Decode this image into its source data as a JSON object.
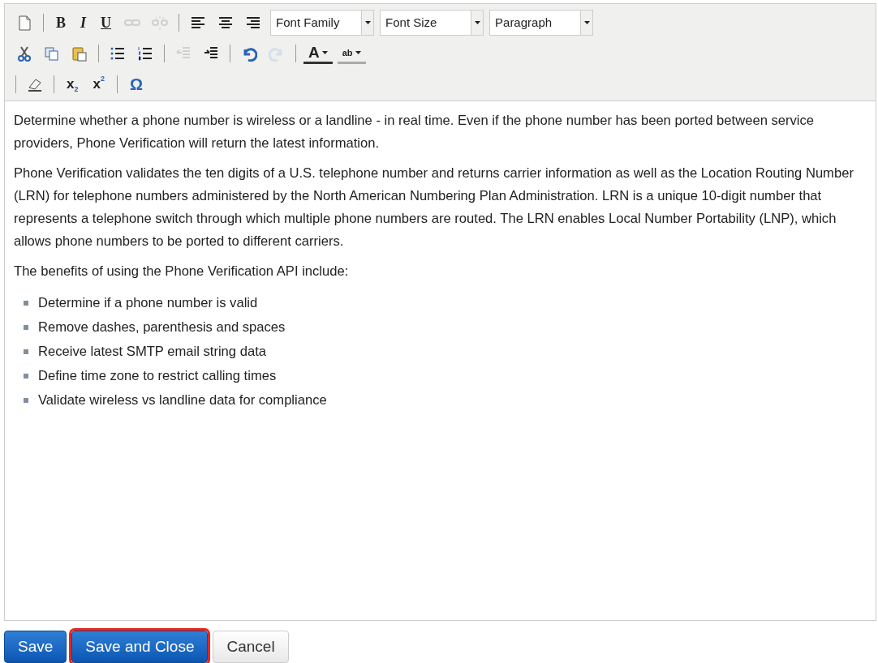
{
  "toolbar": {
    "lines": [
      {
        "items": [
          {
            "kind": "new-document",
            "disabled": false
          },
          {
            "kind": "separator"
          },
          {
            "kind": "bold",
            "glyph": "B",
            "disabled": false
          },
          {
            "kind": "italic",
            "glyph": "I",
            "disabled": false
          },
          {
            "kind": "underline",
            "glyph": "U",
            "disabled": false
          },
          {
            "kind": "link",
            "disabled": true
          },
          {
            "kind": "unlink",
            "disabled": true
          },
          {
            "kind": "separator"
          },
          {
            "kind": "align-left",
            "disabled": false
          },
          {
            "kind": "align-center",
            "disabled": false
          },
          {
            "kind": "align-right",
            "disabled": false
          },
          {
            "kind": "select",
            "value": "Font Family"
          },
          {
            "kind": "select",
            "value": "Font Size"
          },
          {
            "kind": "select",
            "value": "Paragraph"
          }
        ]
      },
      {
        "items": [
          {
            "kind": "cut",
            "disabled": false
          },
          {
            "kind": "copy",
            "disabled": false
          },
          {
            "kind": "paste",
            "disabled": false
          },
          {
            "kind": "separator"
          },
          {
            "kind": "bullet-list",
            "disabled": false
          },
          {
            "kind": "numbered-list",
            "disabled": false
          },
          {
            "kind": "separator"
          },
          {
            "kind": "outdent",
            "disabled": true
          },
          {
            "kind": "indent",
            "disabled": false
          },
          {
            "kind": "separator"
          },
          {
            "kind": "undo",
            "disabled": false
          },
          {
            "kind": "redo",
            "disabled": true
          },
          {
            "kind": "separator"
          },
          {
            "kind": "text-color",
            "glyph": "A",
            "disabled": false
          },
          {
            "kind": "highlight",
            "glyph": "ab",
            "disabled": false
          }
        ]
      },
      {
        "items": [
          {
            "kind": "separator"
          },
          {
            "kind": "eraser",
            "disabled": false
          },
          {
            "kind": "separator"
          },
          {
            "kind": "subscript",
            "glyph": "x",
            "small": "2",
            "disabled": false
          },
          {
            "kind": "superscript",
            "glyph": "x",
            "small": "2",
            "disabled": false
          },
          {
            "kind": "separator"
          },
          {
            "kind": "special-character",
            "glyph": "Ω",
            "disabled": false
          }
        ]
      }
    ]
  },
  "content": {
    "paragraphs": [
      "Determine whether a phone number is wireless or a landline - in real time. Even if the phone number has been ported between service providers, Phone Verification will return the latest information.",
      "Phone Verification validates the ten digits of a U.S. telephone number and returns carrier information as well as the Location Routing Number (LRN) for telephone numbers administered by the North American Numbering Plan Administration. LRN is a unique 10-digit number that represents a telephone switch through which multiple phone numbers are routed. The LRN enables Local Number Portability (LNP), which allows phone numbers to be ported to different carriers.",
      "The benefits of using the Phone Verification API include:"
    ],
    "bullets": [
      "Determine if a phone number is valid",
      "Remove dashes, parenthesis and spaces",
      "Receive latest SMTP email string data",
      "Define time zone to restrict calling times",
      "Validate wireless vs landline data for compliance"
    ]
  },
  "buttons": [
    {
      "label": "Save",
      "kind": "primary",
      "outlined": false
    },
    {
      "label": "Save and Close",
      "kind": "primary",
      "outlined": true
    },
    {
      "label": "Cancel",
      "kind": "default",
      "outlined": false
    }
  ]
}
